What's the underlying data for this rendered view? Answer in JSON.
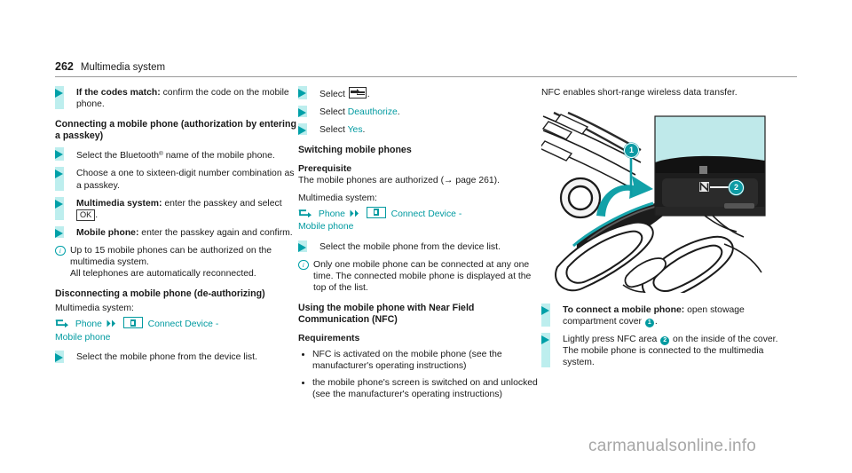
{
  "header": {
    "page_number": "262",
    "chapter": "Multimedia system"
  },
  "column1": {
    "step_codes_match": {
      "bold": "If the codes match:",
      "rest": " confirm the code on the mobile phone."
    },
    "heading_connecting": "Connecting a mobile phone (authorization by entering a passkey)",
    "step_bluetooth_pre": "Select the Bluetooth",
    "step_bluetooth_sup": "®",
    "step_bluetooth_post": " name of the mobile phone.",
    "step_choose": "Choose a one to sixteen-digit number combination as a passkey.",
    "step_multimedia_bold": "Multimedia system:",
    "step_multimedia_rest": " enter the passkey and select ",
    "step_multimedia_key": "OK",
    "step_multimedia_end": ".",
    "step_mobile_bold": "Mobile phone:",
    "step_mobile_rest": " enter the passkey again and confirm.",
    "note_up_to_15": "Up to 15 mobile phones can be authorized on the multimedia system.",
    "note_reconnect": "All telephones are automatically reconnected.",
    "heading_disconnecting": "Disconnecting a mobile phone (de-authorizing)",
    "label_multimedia_system": "Multimedia system:",
    "path_phone": "Phone",
    "path_connect_device": "Connect Device -",
    "path_mobile_phone": "Mobile phone",
    "step_select_from_list": "Select the mobile phone from the device list."
  },
  "column2": {
    "step_select_icon_pre": "Select ",
    "step_select_icon_post": ".",
    "step_select_deauthorize_pre": "Select ",
    "step_select_deauthorize_link": "Deauthorize",
    "step_select_deauthorize_post": ".",
    "step_select_yes_pre": "Select ",
    "step_select_yes_link": "Yes",
    "step_select_yes_post": ".",
    "heading_switching": "Switching mobile phones",
    "heading_prerequisite": "Prerequisite",
    "text_authorized": "The mobile phones are authorized (→ page 261).",
    "label_multimedia_system": "Multimedia system:",
    "path_phone": "Phone",
    "path_connect_device": "Connect Device -",
    "path_mobile_phone": "Mobile phone",
    "step_select_from_list": "Select the mobile phone from the device list.",
    "note_only_one": "Only one mobile phone can be connected at any one time. The connected mobile phone is displayed at the top of the list.",
    "heading_nfc": "Using the mobile phone with Near Field Communication (NFC)",
    "heading_requirements": "Requirements",
    "req_1": "NFC is activated on the mobile phone (see the manufacturer's operating instructions)",
    "req_2": "the mobile phone's screen is switched on and unlocked (see the manufacturer's operating instructions)"
  },
  "column3": {
    "intro": "NFC enables short-range wireless data transfer.",
    "figure_badge_1": "1",
    "figure_badge_2": "2",
    "step_connect_bold": "To connect a mobile phone:",
    "step_connect_rest": " open stowage compartment cover ",
    "step_connect_badge": "1",
    "step_connect_end": ".",
    "step_press_pre": "Lightly press NFC area ",
    "step_press_badge": "2",
    "step_press_post": " on the inside of the cover.",
    "step_press_line2": "The mobile phone is connected to the multimedia system."
  },
  "watermark": "carmanualsonline.info",
  "colors": {
    "teal": "#009aa0",
    "teal_bar": "#bdeeee",
    "figure_accent": "#0d9ba4",
    "rule": "#9a9a9a"
  }
}
